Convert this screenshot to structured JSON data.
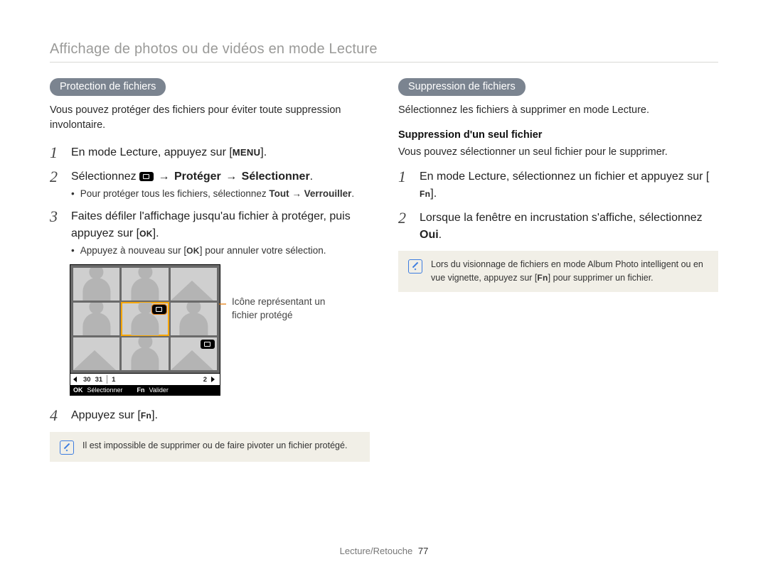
{
  "header": {
    "breadcrumb": "Affichage de photos ou de vidéos en mode Lecture"
  },
  "left": {
    "section_title": "Protection de fichiers",
    "intro": "Vous pouvez protéger des fichiers pour éviter toute suppression involontaire.",
    "step1": {
      "text_a": "En mode Lecture, appuyez sur [",
      "key": "MENU",
      "text_b": "]."
    },
    "step2": {
      "text_a": "Sélectionnez ",
      "text_b": " → ",
      "bold_b": "Protéger",
      "text_c": " → ",
      "bold_c": "Sélectionner",
      "text_d": ".",
      "bullet_a": "Pour protéger tous les fichiers, sélectionnez ",
      "bullet_bold1": "Tout",
      "bullet_arrow": " → ",
      "bullet_bold2": "Verrouiller",
      "bullet_tail": "."
    },
    "step3": {
      "text_a": "Faites défiler l'affichage jusqu'au fichier à protéger, puis appuyez sur [",
      "key": "OK",
      "text_b": "].",
      "bullet_a": "Appuyez à nouveau sur [",
      "bullet_key": "OK",
      "bullet_b": "] pour annuler votre sélection."
    },
    "callout": "Icône représentant un fichier protégé",
    "step4": {
      "text_a": "Appuyez sur [",
      "key": "Fn",
      "text_b": "]."
    },
    "note": "Il est impossible de supprimer ou de faire pivoter un fichier protégé.",
    "screen": {
      "dates": {
        "d1": "30",
        "d2": "31",
        "d3": "1",
        "d4": "2"
      },
      "bar2_ok": "OK",
      "bar2_ok_label": "Sélectionner",
      "bar2_fn": "Fn",
      "bar2_fn_label": "Valider"
    }
  },
  "right": {
    "section_title": "Suppression de fichiers",
    "intro": "Sélectionnez les fichiers à supprimer en mode Lecture.",
    "subheading": "Suppression d'un seul fichier",
    "subintro": "Vous pouvez sélectionner un seul fichier pour le supprimer.",
    "step1": {
      "text_a": "En mode Lecture, sélectionnez un fichier et appuyez sur [",
      "key": "Fn",
      "text_b": "]."
    },
    "step2": {
      "text_a": "Lorsque la fenêtre en incrustation s'affiche, sélectionnez ",
      "bold": "Oui",
      "text_b": "."
    },
    "note_a": "Lors du visionnage de fichiers en mode Album Photo intelligent ou en vue vignette, appuyez sur [",
    "note_key": "Fn",
    "note_b": "] pour supprimer un fichier."
  },
  "footer": {
    "section": "Lecture/Retouche",
    "page": "77"
  }
}
